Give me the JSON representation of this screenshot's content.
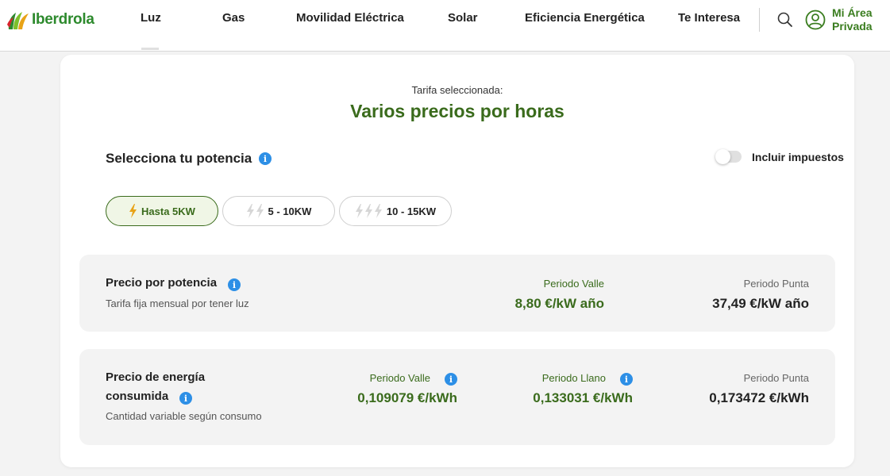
{
  "header": {
    "logo_text": "Iberdrola",
    "nav": [
      {
        "label": "Luz"
      },
      {
        "label": "Gas"
      },
      {
        "label": "Movilidad Eléctrica"
      },
      {
        "label": "Solar"
      },
      {
        "label": "Eficiencia Energética"
      },
      {
        "label": "Te Interesa"
      }
    ],
    "account_line1": "Mi Área",
    "account_line2": "Privada",
    "search_icon": "search-icon",
    "account_icon": "user-circle-icon"
  },
  "tarifa": {
    "label": "Tarifa seleccionada:",
    "title": "Varios precios por horas"
  },
  "potencia": {
    "title": "Selecciona tu potencia",
    "include_taxes_label": "Incluir impuestos",
    "include_taxes_on": false,
    "options": [
      {
        "label": "Hasta 5KW",
        "active": true,
        "bolts": 1
      },
      {
        "label": "5 - 10KW",
        "active": false,
        "bolts": 2
      },
      {
        "label": "10 - 15KW",
        "active": false,
        "bolts": 3
      }
    ]
  },
  "precio_potencia": {
    "title": "Precio por potencia",
    "subtitle": "Tarifa fija mensual por tener luz",
    "valle_label": "Periodo Valle",
    "valle_value": "8,80 €/kW año",
    "punta_label": "Periodo Punta",
    "punta_value": "37,49 €/kW año"
  },
  "precio_energia": {
    "title_line1": "Precio de energía",
    "title_line2": "consumida",
    "subtitle": "Cantidad variable según consumo",
    "valle_label": "Periodo Valle",
    "valle_value": "0,109079 €/kWh",
    "llano_label": "Periodo Llano",
    "llano_value": "0,133031 €/kWh",
    "punta_label": "Periodo Punta",
    "punta_value": "0,173472 €/kWh"
  },
  "colors": {
    "brand_green": "#3a6b1c",
    "logo_green": "#2d8a2d",
    "info_blue": "#2d8fe6",
    "bolt_orange": "#e8a317",
    "panel_grey": "#f3f3f3"
  }
}
